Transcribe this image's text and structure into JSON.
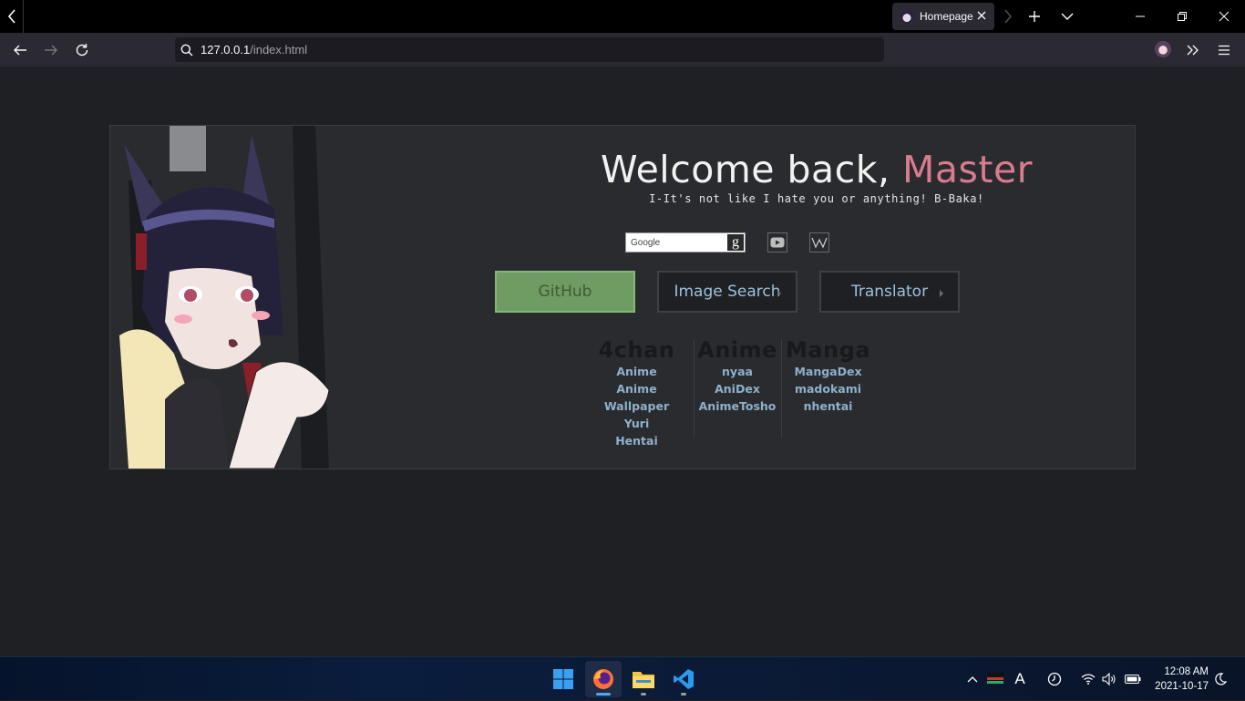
{
  "browser": {
    "tab": {
      "title": "Homepage"
    },
    "url": {
      "host": "127.0.0.1",
      "path": "/index.html"
    }
  },
  "page": {
    "welcome_prefix": "Welcome back, ",
    "welcome_name": "Master",
    "subtitle": "I-It's not like I hate you or anything! B-Baka!",
    "search": {
      "placeholder": "Google",
      "google_glyph": "g"
    },
    "buttons": [
      {
        "label": "GitHub",
        "active": true
      },
      {
        "label": "Image Search",
        "has_caret": true
      },
      {
        "label": "Translator",
        "has_caret": true
      }
    ],
    "link_columns": [
      {
        "heading": "4chan",
        "links": [
          "Anime",
          "Anime Wallpaper",
          "Yuri",
          "Hentai"
        ]
      },
      {
        "heading": "Anime",
        "links": [
          "nyaa",
          "AniDex",
          "AnimeTosho"
        ]
      },
      {
        "heading": "Manga",
        "links": [
          "MangaDex",
          "madokami",
          "nhentai"
        ]
      }
    ],
    "colors": {
      "accent_name": "#d97c8e",
      "link": "#8fb0cc",
      "active_button": "#6e9c62",
      "background": "#1f2023"
    }
  },
  "taskbar": {
    "apps": [
      "windows-start",
      "firefox",
      "file-explorer",
      "vscode"
    ],
    "clock": {
      "time": "12:08 AM",
      "date": "2021-10-17"
    },
    "input_indicator": "A"
  }
}
